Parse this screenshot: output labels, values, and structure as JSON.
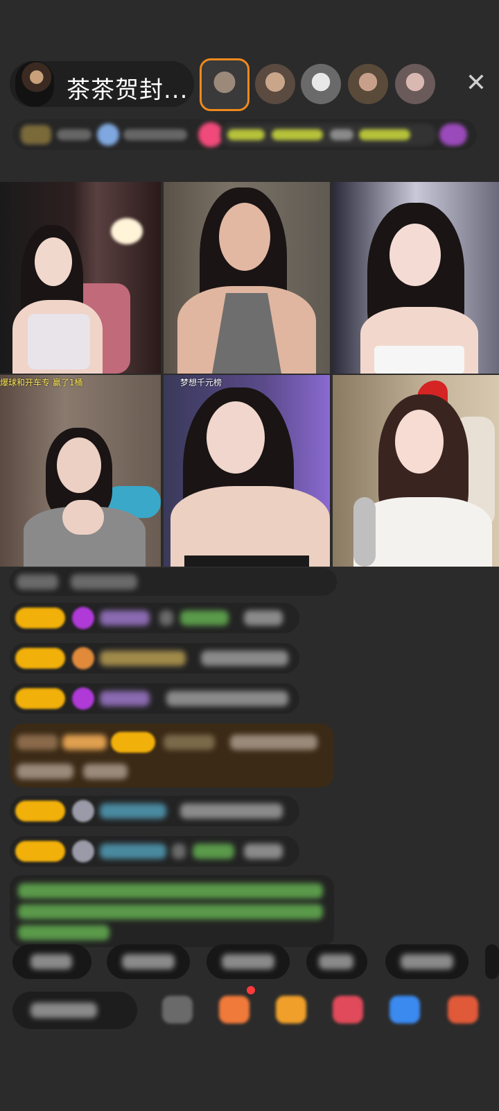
{
  "header": {
    "host_name": "茶茶贺封...",
    "close_symbol": "✕"
  },
  "grid": {
    "captions": {
      "cell4": "爆球和开车专 赢了1桶",
      "cell5": "梦想千元榜"
    }
  },
  "colors": {
    "background": "#2b2b2b",
    "badge": "#f2b10a",
    "highlight_row": "#3b2a16",
    "system_text": "#7ed36a"
  }
}
